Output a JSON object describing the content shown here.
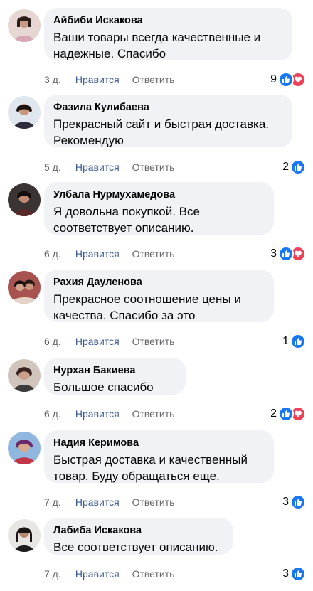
{
  "comments": [
    {
      "author": "Айбиби Искакова",
      "text": "Ваши товары всегда качественные и надежные. Спасибо",
      "time": "3 д.",
      "like": "Нравится",
      "reply": "Ответить",
      "reaction_count": "9",
      "reactions": [
        "like",
        "love"
      ]
    },
    {
      "author": "Фазила Кулибаева",
      "text": "Прекрасный сайт и быстрая доставка. Рекомендую",
      "time": "5 д.",
      "like": "Нравится",
      "reply": "Ответить",
      "reaction_count": "2",
      "reactions": [
        "like"
      ]
    },
    {
      "author": "Улбала Нурмухамедова",
      "text": "Я довольна покупкой. Все соответствует описанию.",
      "time": "6 д.",
      "like": "Нравится",
      "reply": "Ответить",
      "reaction_count": "3",
      "reactions": [
        "like",
        "love"
      ]
    },
    {
      "author": "Рахия Дауленова",
      "text": "Прекрасное соотношение цены и качества. Спасибо за это",
      "time": "6 д.",
      "like": "Нравится",
      "reply": "Ответить",
      "reaction_count": "1",
      "reactions": [
        "like"
      ]
    },
    {
      "author": "Нурхан Бакиева",
      "text": "Большое спасибо",
      "time": "6 д.",
      "like": "Нравится",
      "reply": "Ответить",
      "reaction_count": "2",
      "reactions": [
        "like",
        "love"
      ]
    },
    {
      "author": "Надия Керимова",
      "text": "Быстрая доставка и качественный товар. Буду обращаться еще.",
      "time": "7 д.",
      "like": "Нравится",
      "reply": "Ответить",
      "reaction_count": "3",
      "reactions": [
        "like"
      ]
    },
    {
      "author": "Лабиба Искакова",
      "text": "Все соответствует описанию.",
      "time": "7 д.",
      "like": "Нравится",
      "reply": "Ответить",
      "reaction_count": "3",
      "reactions": [
        "like"
      ]
    }
  ],
  "colors": {
    "like_link": "#385898",
    "bubble": "#f0f2f5",
    "like_reaction": "#1877f2",
    "love_reaction": "#f33e58",
    "meta": "#65676b"
  }
}
